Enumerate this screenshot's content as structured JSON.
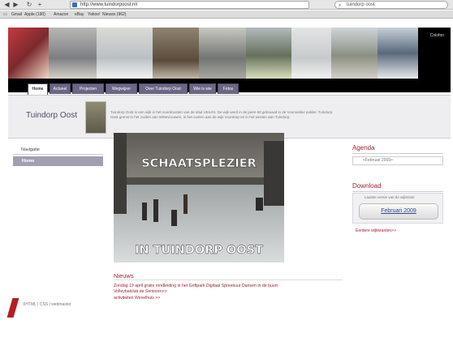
{
  "browser": {
    "back": "◀",
    "forward": "▶",
    "reload": "↻",
    "add": "+",
    "url": "http://www.tuindorpoost.nl/",
    "search_text": "tuindorp oost",
    "bookmarks": [
      "Gmail",
      "Apple (190)",
      "Amazon",
      "eBay",
      "Yahoo!",
      "Nieuws (962)"
    ]
  },
  "header": {
    "site_label": "Colofon"
  },
  "tabs": [
    "Home",
    "Actueel",
    "Projecten",
    "Wegwijzer",
    "Over Tuindorp Oost",
    "Wie is wie",
    "Fotos"
  ],
  "site": {
    "title": "Tuindorp Oost",
    "intro": "Tuindorp Oost is een wijk in het noordoosten van de stad Utrecht. De wijk werd in de jaren 50 gebouwd in de Voorveldse polder. Tuindorp Oost grenst in het zuiden aan Wittevrouwen, in het oosten aan de wijk Voordorp en in het westen aan Tuindorp."
  },
  "nav": {
    "title": "Navigatie",
    "home": "Home"
  },
  "poster": {
    "top_text": "SCHAATSPLEZIER",
    "bottom_text": "IN TUINDORP OOST"
  },
  "news": {
    "title": "Nieuws",
    "items": [
      "Zondag 19 april gratis rondleiding in het Griftpark Digitaal Spreekuur Dansen in de buurt-",
      "Volleybalclub de Senioren>>",
      "activiteiten Wevelhuis >>"
    ]
  },
  "agenda": {
    "title": "Agenda",
    "selected": "<Februari 2009>"
  },
  "download": {
    "title": "Download",
    "note": "Laatste versie van de wijkkrant",
    "button": "Februari 2009",
    "more": "Eerdere wijkkranten>>"
  },
  "footer": {
    "text": "XHTML | CSS | webmaster"
  },
  "colors": {
    "accent": "#a02030",
    "tab_bg": "#6b6785",
    "nav_active": "#a0a0b2"
  }
}
